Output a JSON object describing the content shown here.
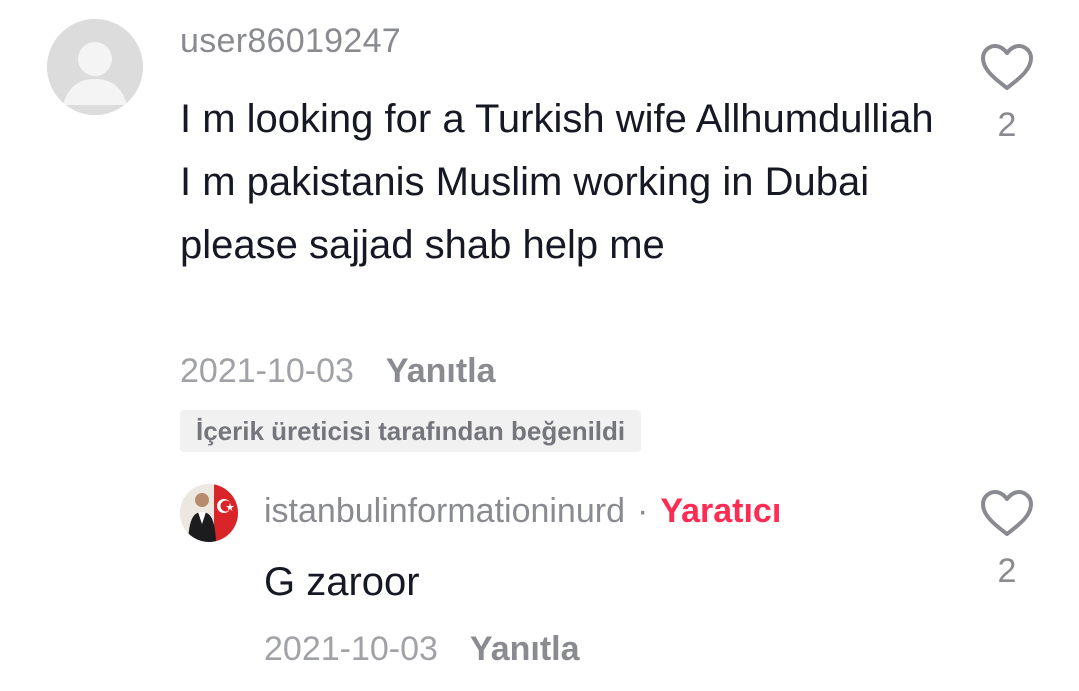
{
  "comment": {
    "username": "user86019247",
    "text": "I m looking for a Turkish wife Allhumdulliah I m pakistanis Muslim working in Dubai please sajjad shab help me",
    "date": "2021-10-03",
    "reply_label": "Yanıtla",
    "liked_by_creator": "İçerik üreticisi tarafından beğenildi",
    "like_count": "2",
    "like_icon": "heart-outline-icon"
  },
  "reply": {
    "username": "istanbulinformationinurd",
    "separator": "·",
    "creator_badge": "Yaratıcı",
    "text": "G zaroor",
    "date": "2021-10-03",
    "reply_label": "Yanıtla",
    "like_count": "2",
    "like_icon": "heart-outline-icon"
  },
  "colors": {
    "text_primary": "#161823",
    "text_secondary": "#8a8b91",
    "accent": "#fe2c55",
    "badge_bg": "#f1f1f2"
  }
}
